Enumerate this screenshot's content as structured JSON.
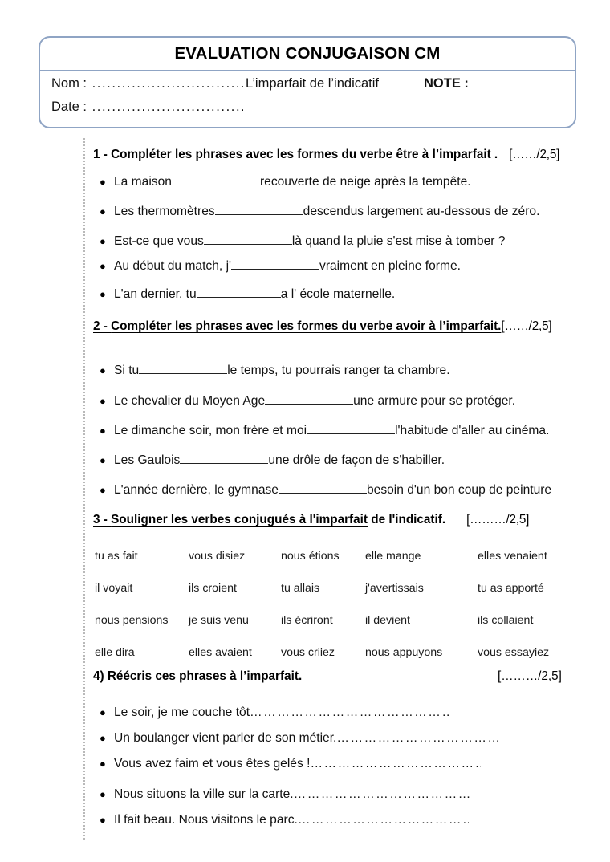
{
  "header": {
    "title": "EVALUATION CONJUGAISON CM",
    "name_label": "Nom : ",
    "name_dots": "................................",
    "date_label": "Date : ",
    "date_dots": "...............................",
    "subject": "L’imparfait de l’indicatif",
    "note_label": "NOTE :",
    "border_color": "#8fa4c4"
  },
  "exercises": [
    {
      "number": "1 - ",
      "title": "Compléter les phrases avec les formes du verbe être à l’imparfait .",
      "score": "[……/2,5]",
      "items": [
        {
          "before": "La maison",
          "blank": 110,
          "after": " recouverte de neige après la tempête."
        },
        {
          "before": "Les thermomètres",
          "blank": 110,
          "after": " descendus largement au-dessous de zéro."
        },
        {
          "before": "Est-ce que vous ",
          "blank": 110,
          "after": " là quand la pluie s'est mise à tomber ?"
        },
        {
          "before": "Au début du match, j'",
          "blank": 110,
          "after": " vraiment en pleine forme."
        },
        {
          "before": "L'an dernier, tu ",
          "blank": 105,
          "after": " a l' école maternelle."
        }
      ]
    },
    {
      "number": "2 - ",
      "title": "Compléter les phrases avec les formes du verbe avoir à l’imparfait.",
      "score": "[……/2,5]",
      "items": [
        {
          "before": "Si tu",
          "blank": 110,
          "after": " le temps, tu pourrais ranger ta chambre."
        },
        {
          "before": "Le chevalier du Moyen Age",
          "blank": 110,
          "after": " une armure pour se protéger."
        },
        {
          "before": "Le dimanche soir, mon frère et moi",
          "blank": 110,
          "after": "l'habitude d'aller au cinéma."
        },
        {
          "before": "Les Gaulois",
          "blank": 110,
          "after": " une drôle de façon de s'habiller."
        },
        {
          "before": "L'année dernière, le gymnase ",
          "blank": 110,
          "after": "besoin d'un bon coup de peinture"
        }
      ]
    },
    {
      "number": "3 - ",
      "title_underlined": "Souligner les verbes conjugués à l'imparfait",
      "title_plain": " de l'indicatif.",
      "score": "[………/2,5]"
    },
    {
      "number": "4) ",
      "title": "Réécris ces phrases à l’imparfait.",
      "score": "[………/2,5]",
      "items": [
        {
          "text": "Le soir, je me couche tôt",
          "dots": "…………………………………………………………",
          "dots_width": 250
        },
        {
          "text": "Un boulanger vient parler de son métier. ",
          "dots": "…………………………………………………",
          "dots_width": 205
        },
        {
          "text": "Vous avez faim et vous êtes gelés ! ",
          "dots": "……………………………………………………",
          "dots_width": 213
        },
        {
          "text": "Nous situons la ville sur la carte. ",
          "dots": "……………………………………………………",
          "dots_width": 220
        },
        {
          "text": "Il fait beau. Nous visitons le parc. ",
          "dots": "……………………………………………………",
          "dots_width": 213
        }
      ]
    }
  ],
  "verb_grid": {
    "rows": [
      [
        "tu as fait",
        "vous disiez",
        "nous étions",
        "elle mange",
        "elles venaient"
      ],
      [
        "il voyait",
        "ils croient",
        "tu allais",
        "j'avertissais",
        "tu as apporté"
      ],
      [
        "nous pensions",
        "je suis venu",
        "ils écriront",
        "il devient",
        "ils collaient"
      ],
      [
        "elle dira",
        "elles avaient",
        "vous criiez",
        "nous appuyons",
        "vous essayiez"
      ]
    ]
  }
}
